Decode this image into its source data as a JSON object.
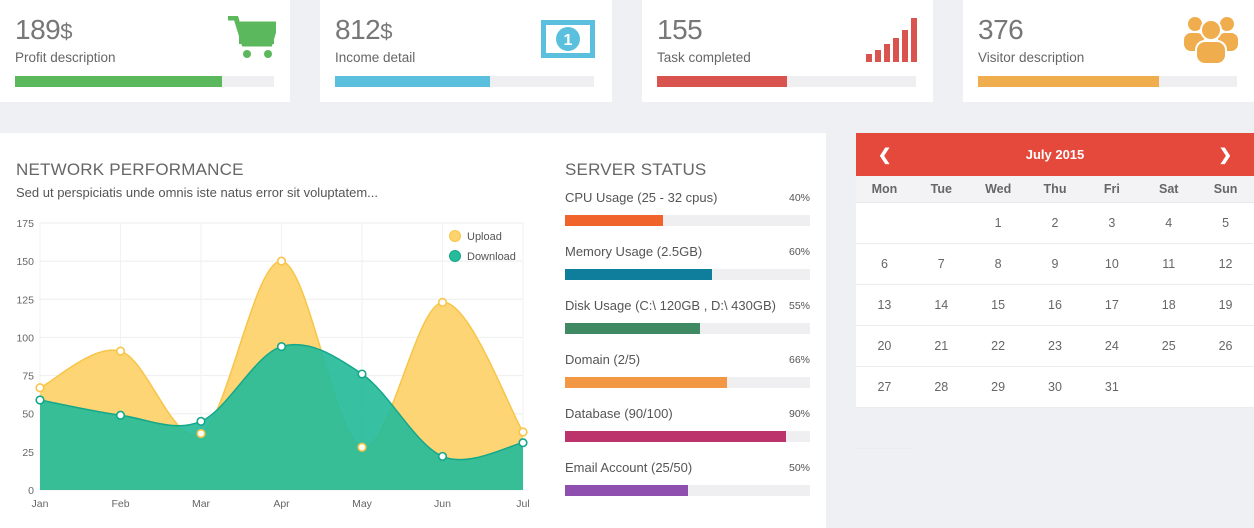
{
  "stats": [
    {
      "value": "189",
      "unit": "$",
      "desc": "Profit description",
      "color": "#5cb85c",
      "fill": 0.8,
      "icon": "cart-icon"
    },
    {
      "value": "812",
      "unit": "$",
      "desc": "Income detail",
      "color": "#5bc0de",
      "fill": 0.6,
      "icon": "money-icon"
    },
    {
      "value": "155",
      "unit": "",
      "desc": "Task completed",
      "color": "#d9534f",
      "fill": 0.5,
      "icon": "bar-chart-icon"
    },
    {
      "value": "376",
      "unit": "",
      "desc": "Visitor description",
      "color": "#f0ad4e",
      "fill": 0.7,
      "icon": "users-icon"
    }
  ],
  "network": {
    "title": "NETWORK PERFORMANCE",
    "subtitle": "Sed ut perspiciatis unde omnis iste natus error sit voluptatem..."
  },
  "chart_data": {
    "type": "area",
    "categories": [
      "Jan",
      "Feb",
      "Mar",
      "Apr",
      "May",
      "Jun",
      "Jul"
    ],
    "series": [
      {
        "name": "Upload",
        "values": [
          67,
          91,
          37,
          150,
          28,
          123,
          38
        ],
        "color": "#fdd36e"
      },
      {
        "name": "Download",
        "values": [
          59,
          49,
          45,
          94,
          76,
          22,
          31
        ],
        "color": "#26bc9a"
      }
    ],
    "yticks": [
      0,
      25,
      50,
      75,
      100,
      125,
      150,
      175
    ],
    "ylim": [
      0,
      175
    ],
    "grid": true,
    "legend": "top-right"
  },
  "server": {
    "title": "SERVER STATUS",
    "items": [
      {
        "label": "CPU Usage (25 - 32 cpus)",
        "pct": "40%",
        "fill": 0.4,
        "color": "#f0642c"
      },
      {
        "label": "Memory Usage (2.5GB)",
        "pct": "60%",
        "fill": 0.6,
        "color": "#0e7e9c"
      },
      {
        "label": "Disk Usage (C:\\ 120GB , D:\\ 430GB)",
        "pct": "55%",
        "fill": 0.55,
        "color": "#3f8a62"
      },
      {
        "label": "Domain (2/5)",
        "pct": "66%",
        "fill": 0.66,
        "color": "#f29743"
      },
      {
        "label": "Database (90/100)",
        "pct": "90%",
        "fill": 0.9,
        "color": "#bc326b"
      },
      {
        "label": "Email Account (25/50)",
        "pct": "50%",
        "fill": 0.5,
        "color": "#8f4fae"
      }
    ]
  },
  "calendar": {
    "title": "July 2015",
    "prev": "❮",
    "next": "❯",
    "weekdays": [
      "Mon",
      "Tue",
      "Wed",
      "Thu",
      "Fri",
      "Sat",
      "Sun"
    ],
    "cells": [
      "",
      "",
      "1",
      "2",
      "3",
      "4",
      "5",
      "6",
      "7",
      "8",
      "9",
      "10",
      "11",
      "12",
      "13",
      "14",
      "15",
      "16",
      "17",
      "18",
      "19",
      "20",
      "21",
      "22",
      "23",
      "24",
      "25",
      "26",
      "27",
      "28",
      "29",
      "30",
      "31",
      "",
      "",
      ""
    ]
  }
}
